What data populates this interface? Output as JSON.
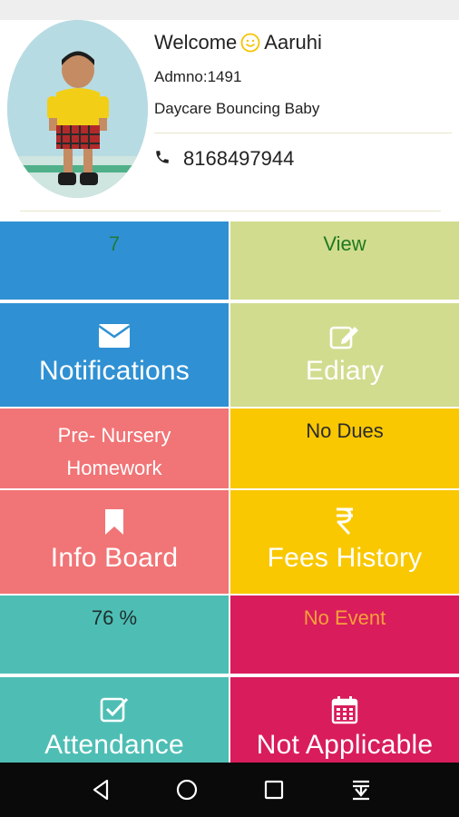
{
  "profile": {
    "welcome": "Welcome",
    "name": "Aaruhi",
    "admno": "Admno:1491",
    "school": "Daycare Bouncing Baby",
    "phone": "8168497944"
  },
  "tiles": {
    "notifications": {
      "value": "7",
      "label": "Notifications",
      "icon": "envelope-icon",
      "bg": "#2f91d3",
      "value_color": "#1f7a3a"
    },
    "ediary": {
      "value": "View",
      "label": "Ediary",
      "icon": "edit-icon",
      "bg": "#d1dc8f",
      "value_color": "#1f7a1f"
    },
    "info_board": {
      "value": "Pre- Nursery\nHomework",
      "label": "Info Board",
      "icon": "bookmark-icon",
      "bg": "#f17476",
      "value_color": "#ffffff"
    },
    "fees_history": {
      "value": "No Dues",
      "label": "Fees History",
      "icon": "rupee-icon",
      "bg": "#f9c800",
      "value_color": "#2b2b2b"
    },
    "attendance": {
      "value": "76 %",
      "label": "Attendance",
      "icon": "check-square-icon",
      "bg": "#4ebeb4",
      "value_color": "#1e2e2e"
    },
    "events": {
      "value": "No Event",
      "label": "Not Applicable",
      "icon": "calendar-icon",
      "bg": "#d91c5c",
      "value_color": "#f6a13a"
    }
  },
  "navbar": {
    "icons": [
      "back-icon",
      "home-icon",
      "recents-icon",
      "notification-shade-icon"
    ]
  }
}
